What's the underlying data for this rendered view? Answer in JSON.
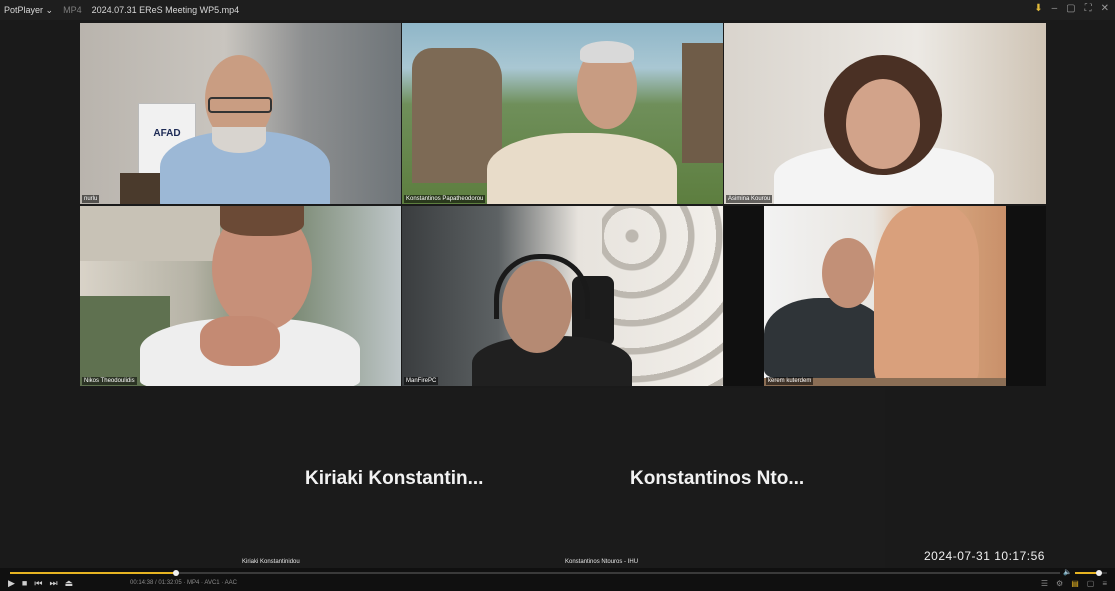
{
  "titlebar": {
    "app_name": "PotPlayer",
    "format": "MP4",
    "filename": "2024.07.31 EReS Meeting WP5.mp4",
    "icons": [
      "pin-icon",
      "minimize-icon",
      "restore-icon",
      "resize-icon",
      "close-icon"
    ]
  },
  "participants": [
    {
      "name": "nurlu",
      "sign_text": "AFAD"
    },
    {
      "name": "Konstantinos Papatheodorou"
    },
    {
      "name": "Asimina Kourou"
    },
    {
      "name": "Nikos Theodoulidis"
    },
    {
      "name": "ManFirePC"
    },
    {
      "name": "kerem kuterdem"
    }
  ],
  "no_video": [
    {
      "display": "Kiriaki  Konstantin...",
      "label": "Kiriaki Konstantinidou"
    },
    {
      "display": "Konstantinos  Nto...",
      "label": "Konstantinos Ntouros - IHU"
    }
  ],
  "overlay": {
    "timestamp": "2024-07-31  10:17:56"
  },
  "playback": {
    "progress": 0.158,
    "volume": 0.75,
    "time_text": "00:14:38 / 01:32:05  ·  MP4  ·  AVC1  ·  AAC",
    "accent_color": "#e6b422"
  }
}
